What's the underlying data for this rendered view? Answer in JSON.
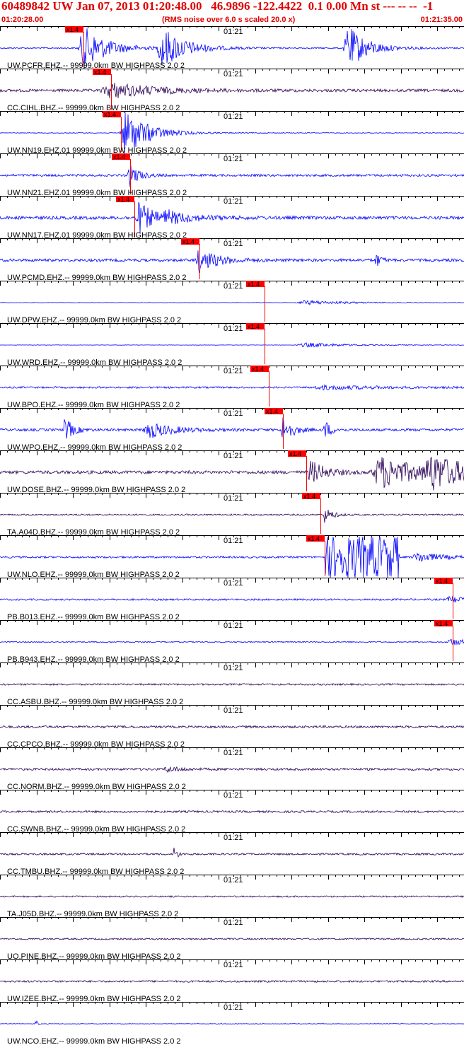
{
  "header": {
    "title": "60489842 UW Jan 07, 2013 01:20:48.00   46.9896 -122.4422  0.1 0.00 Mn st --- -- --  -1",
    "start_time": "01:20:28.00",
    "note": "(RMS noise over 6.0 s scaled 20.0 x)",
    "end_time": "01:21:35.00"
  },
  "colors": {
    "header_text": "#e00000",
    "trace_blue": "#0000ff",
    "trace_dark": "#2a0055",
    "pick_box": "#ff0000",
    "pick_line": "#ff0000",
    "axis": "#000000"
  },
  "chart_data": {
    "type": "line",
    "title": "60489842 UW Jan 07, 2013 01:20:48.00   46.9896 -122.4422  0.1 0.00 Mn st --- -- --  -1",
    "x_range": [
      "01:20:28.00",
      "01:21:35.00"
    ],
    "minute_tick_label": "01:21",
    "pick_label": "x1.4",
    "series": [
      {
        "name": "UW.PCFR.EHZ.--.99999.0km.BW..HIGHPASS..2.0..2",
        "label": "UW.PCFR.EHZ.-- 99999.0km BW  HIGHPASS  2.0  2",
        "color": "blue",
        "pick_frac": 0.18,
        "bursts": [
          [
            0.18,
            0.03,
            3.5
          ],
          [
            0.35,
            0.03,
            3.2
          ],
          [
            0.75,
            0.025,
            3.5
          ]
        ],
        "base": 0.12
      },
      {
        "name": "CC.CIHL.BHZ.--.99999.0km.BW..HIGHPASS..2.0..2",
        "label": "CC.CIHL.BHZ.-- 99999.0km BW  HIGHPASS  2.0  2",
        "color": "dark",
        "pick_frac": 0.24,
        "bursts": [
          [
            0.24,
            0.06,
            1.2
          ]
        ],
        "base": 0.22
      },
      {
        "name": "UW.NN19.EHZ.01.99999.0km.BW..HIGHPASS..2.0..2",
        "label": "UW.NN19.EHZ.01 99999.0km BW  HIGHPASS  2.0  2",
        "color": "blue",
        "pick_frac": 0.26,
        "bursts": [
          [
            0.27,
            0.03,
            3.8
          ]
        ],
        "base": 0.06
      },
      {
        "name": "UW.NN21.EHZ.01.99999.0km.BW..HIGHPASS..2.0..2",
        "label": "UW.NN21.EHZ.01 99999.0km BW  HIGHPASS  2.0  2",
        "color": "blue",
        "pick_frac": 0.28,
        "bursts": [
          [
            0.28,
            0.012,
            1.8
          ]
        ],
        "base": 0.18
      },
      {
        "name": "UW.NN17.EHZ.01.99999.0km.BW..HIGHPASS..2.0..2",
        "label": "UW.NN17.EHZ.01 99999.0km BW  HIGHPASS  2.0  2",
        "color": "blue",
        "pick_frac": 0.29,
        "bursts": [
          [
            0.3,
            0.02,
            2.4
          ],
          [
            0.36,
            0.04,
            0.8
          ]
        ],
        "base": 0.25
      },
      {
        "name": "UW.PCMD.EHZ.--.99999.0km.BW..HIGHPASS..2.0..2",
        "label": "UW.PCMD.EHZ.-- 99999.0km BW  HIGHPASS  2.0  2",
        "color": "blue",
        "pick_frac": 0.43,
        "bursts": [
          [
            0.43,
            0.025,
            1.8
          ],
          [
            0.81,
            0.006,
            1.2
          ]
        ],
        "base": 0.22
      },
      {
        "name": "UW.DPW.EHZ.--.99999.0km.BW..HIGHPASS..2.0..2",
        "label": "UW.DPW.EHZ.-- 99999.0km BW  HIGHPASS  2.0  2",
        "color": "blue",
        "pick_frac": 0.57,
        "bursts": [
          [
            0.66,
            0.06,
            0.35
          ]
        ],
        "base": 0.03
      },
      {
        "name": "UW.WRD.EHZ.--.99999.0km.BW..HIGHPASS..2.0..2",
        "label": "UW.WRD.EHZ.-- 99999.0km BW  HIGHPASS  2.0  2",
        "color": "blue",
        "pick_frac": 0.57,
        "bursts": [
          [
            0.66,
            0.06,
            0.35
          ]
        ],
        "base": 0.03
      },
      {
        "name": "UW.BPO.EHZ.--.99999.0km.BW..HIGHPASS..2.0..2",
        "label": "UW.BPO.EHZ.-- 99999.0km BW  HIGHPASS  2.0  2",
        "color": "blue",
        "pick_frac": 0.58,
        "bursts": [
          [
            0.7,
            0.08,
            0.3
          ]
        ],
        "base": 0.14
      },
      {
        "name": "UW.WPO.EHZ.--.99999.0km.BW..HIGHPASS..2.0..2",
        "label": "UW.WPO.EHZ.-- 99999.0km BW  HIGHPASS  2.0  2",
        "color": "blue",
        "pick_frac": 0.61,
        "bursts": [
          [
            0.14,
            0.01,
            2.0
          ],
          [
            0.32,
            0.03,
            1.3
          ],
          [
            0.61,
            0.012,
            2.2
          ],
          [
            0.7,
            0.008,
            1.5
          ]
        ],
        "base": 0.2
      },
      {
        "name": "UW.DOSE.BHZ.--.99999.0km.BW..HIGHPASS..2.0..2",
        "label": "UW.DOSE.BHZ.-- 99999.0km BW  HIGHPASS  2.0  2",
        "color": "dark",
        "pick_frac": 0.66,
        "bursts": [
          [
            0.67,
            0.02,
            1.8
          ],
          [
            0.82,
            0.05,
            2.6
          ],
          [
            0.93,
            0.05,
            2.4
          ]
        ],
        "base": 0.25
      },
      {
        "name": "TA.A04D.BHZ.--.99999.0km.BW..HIGHPASS..2.0..2",
        "label": "TA.A04D.BHZ.-- 99999.0km BW  HIGHPASS  2.0  2",
        "color": "dark",
        "pick_frac": 0.69,
        "bursts": [
          [
            0.7,
            0.01,
            1.2
          ]
        ],
        "base": 0.12
      },
      {
        "name": "UW.NLO.EHZ.--.99999.0km.BW..HIGHPASS..2.0..2",
        "label": "UW.NLO.EHZ.-- 99999.0km BW  HIGHPASS  2.0  2",
        "color": "blue",
        "pick_frac": 0.7,
        "clip": [
          0.7,
          0.86
        ],
        "bursts": [
          [
            0.9,
            0.03,
            0.8
          ]
        ],
        "base": 0.15
      },
      {
        "name": "PB.B013.EHZ.--.99999.0km.BW..HIGHPASS..2.0..2",
        "label": "PB.B013.EHZ.-- 99999.0km BW  HIGHPASS  2.0  2",
        "color": "blue",
        "pick_frac": 0.975,
        "bursts": [
          [
            0.97,
            0.02,
            0.6
          ]
        ],
        "base": 0.14
      },
      {
        "name": "PB.B943.EHZ.--.99999.0km.BW..HIGHPASS..2.0..2",
        "label": "PB.B943.EHZ.-- 99999.0km BW  HIGHPASS  2.0  2",
        "color": "blue",
        "pick_frac": 0.975,
        "bursts": [
          [
            0.97,
            0.02,
            0.6
          ]
        ],
        "base": 0.09
      },
      {
        "name": "CC.ASBU.BHZ.--.99999.0km.BW..HIGHPASS..2.0..2",
        "label": "CC.ASBU.BHZ.-- 99999.0km BW  HIGHPASS  2.0  2",
        "color": "dark",
        "pick_frac": null,
        "bursts": [],
        "base": 0.14
      },
      {
        "name": "CC.CPCO.BHZ.--.99999.0km.BW..HIGHPASS..2.0..2",
        "label": "CC.CPCO.BHZ.-- 99999.0km BW  HIGHPASS  2.0  2",
        "color": "dark",
        "pick_frac": null,
        "bursts": [],
        "base": 0.18
      },
      {
        "name": "CC.NORM.BHZ.--.99999.0km.BW..HIGHPASS..2.0..2",
        "label": "CC.NORM.BHZ.-- 99999.0km BW  HIGHPASS  2.0  2",
        "color": "dark",
        "pick_frac": null,
        "bursts": [
          [
            0.36,
            0.02,
            0.4
          ]
        ],
        "base": 0.18
      },
      {
        "name": "CC.SWNB.BHZ.--.99999.0km.BW..HIGHPASS..2.0..2",
        "label": "CC.SWNB.BHZ.-- 99999.0km BW  HIGHPASS  2.0  2",
        "color": "dark",
        "pick_frac": null,
        "bursts": [],
        "base": 0.16
      },
      {
        "name": "CC.TMBU.BHZ.--.99999.0km.BW..HIGHPASS..2.0..2",
        "label": "CC.TMBU.BHZ.-- 99999.0km BW  HIGHPASS  2.0  2",
        "color": "dark",
        "pick_frac": null,
        "bursts": [
          [
            0.375,
            0.004,
            1.3
          ]
        ],
        "base": 0.15
      },
      {
        "name": "TA.J05D.BHZ.--.99999.0km.BW..HIGHPASS..2.0..2",
        "label": "TA.J05D.BHZ.-- 99999.0km BW  HIGHPASS  2.0  2",
        "color": "dark",
        "pick_frac": null,
        "bursts": [],
        "base": 0.12
      },
      {
        "name": "UO.PINE.BHZ.--.99999.0km.BW..HIGHPASS..2.0..2",
        "label": "UO.PINE.BHZ.-- 99999.0km BW  HIGHPASS  2.0  2",
        "color": "dark",
        "pick_frac": null,
        "bursts": [],
        "base": 0.13
      },
      {
        "name": "UW.IZEE.BHZ.--.99999.0km.BW..HIGHPASS..2.0..2",
        "label": "UW.IZEE.BHZ.-- 99999.0km BW  HIGHPASS  2.0  2",
        "color": "dark",
        "pick_frac": null,
        "bursts": [],
        "base": 0.15
      },
      {
        "name": "UW.NCO.EHZ.--.99999.0km.BW..HIGHPASS..2.0..2",
        "label": "UW.NCO.EHZ.-- 99999.0km BW  HIGHPASS  2.0  2",
        "color": "blue",
        "pick_frac": null,
        "bursts": [
          [
            0.075,
            0.002,
            1.6
          ]
        ],
        "base": 0.04
      }
    ]
  }
}
